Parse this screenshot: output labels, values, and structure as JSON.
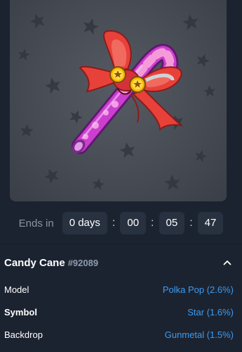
{
  "gift": {
    "name": "Candy Cane",
    "number": "#92089"
  },
  "timer": {
    "label": "Ends in",
    "days": "0 days",
    "hours": "00",
    "minutes": "05",
    "seconds": "47",
    "separator": ":"
  },
  "attributes": [
    {
      "name": "Model",
      "value": "Polka Pop (2.6%)"
    },
    {
      "name": "Symbol",
      "value": "Star (1.6%)"
    },
    {
      "name": "Backdrop",
      "value": "Gunmetal (1.5%)"
    }
  ],
  "colors": {
    "background": "#1c2330",
    "accent": "#3d9bf0",
    "chip": "#283140",
    "backdrop": "#4a4f57"
  },
  "icons": {
    "collapse": "chevron-up-icon",
    "pattern": "star-icon"
  }
}
